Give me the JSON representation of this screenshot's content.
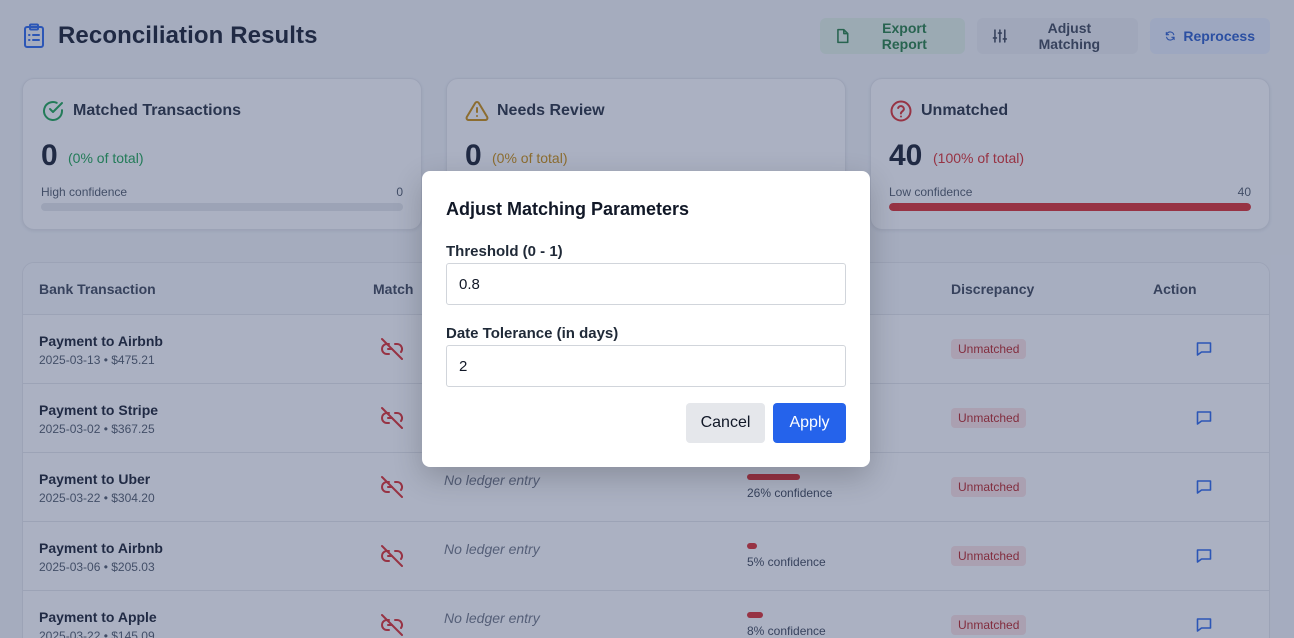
{
  "page": {
    "title": "Reconciliation Results",
    "title_icon": "clipboard-list-icon"
  },
  "toolbar": {
    "export_label": "Export Report",
    "adjust_label": "Adjust Matching",
    "reprocess_label": "Reprocess"
  },
  "summary": {
    "matched": {
      "title": "Matched Transactions",
      "count": "0",
      "pct": "(0% of total)",
      "confidence_label": "High confidence",
      "confidence_count": "0",
      "fill": 0,
      "color": "#16a34a"
    },
    "review": {
      "title": "Needs Review",
      "count": "0",
      "pct": "(0% of total)",
      "color": "#ca8a04"
    },
    "unmatched": {
      "title": "Unmatched",
      "count": "40",
      "pct": "(100% of total)",
      "confidence_label": "Low confidence",
      "confidence_count": "40",
      "fill": 1,
      "color": "#dc2626"
    }
  },
  "table": {
    "headers": {
      "bank": "Bank Transaction",
      "match": "Match",
      "discrepancy": "Discrepancy",
      "action": "Action"
    },
    "rows": [
      {
        "name": "Payment to Airbnb",
        "meta": "2025-03-13 • $475.21",
        "ledger": "",
        "confidence": null,
        "confidence_text": "",
        "status": "Unmatched"
      },
      {
        "name": "Payment to Stripe",
        "meta": "2025-03-02 • $367.25",
        "ledger": "",
        "confidence": null,
        "confidence_text": "",
        "status": "Unmatched"
      },
      {
        "name": "Payment to Uber",
        "meta": "2025-03-22 • $304.20",
        "ledger": "No ledger entry",
        "confidence": 26,
        "confidence_text": "26% confidence",
        "status": "Unmatched"
      },
      {
        "name": "Payment to Airbnb",
        "meta": "2025-03-06 • $205.03",
        "ledger": "No ledger entry",
        "confidence": 5,
        "confidence_text": "5% confidence",
        "status": "Unmatched"
      },
      {
        "name": "Payment to Apple",
        "meta": "2025-03-22 • $145.09",
        "ledger": "No ledger entry",
        "confidence": 8,
        "confidence_text": "8% confidence",
        "status": "Unmatched"
      }
    ]
  },
  "modal": {
    "title": "Adjust Matching Parameters",
    "threshold_label": "Threshold (0 - 1)",
    "threshold_value": "0.8",
    "tolerance_label": "Date Tolerance (in days)",
    "tolerance_value": "2",
    "cancel_label": "Cancel",
    "apply_label": "Apply"
  }
}
